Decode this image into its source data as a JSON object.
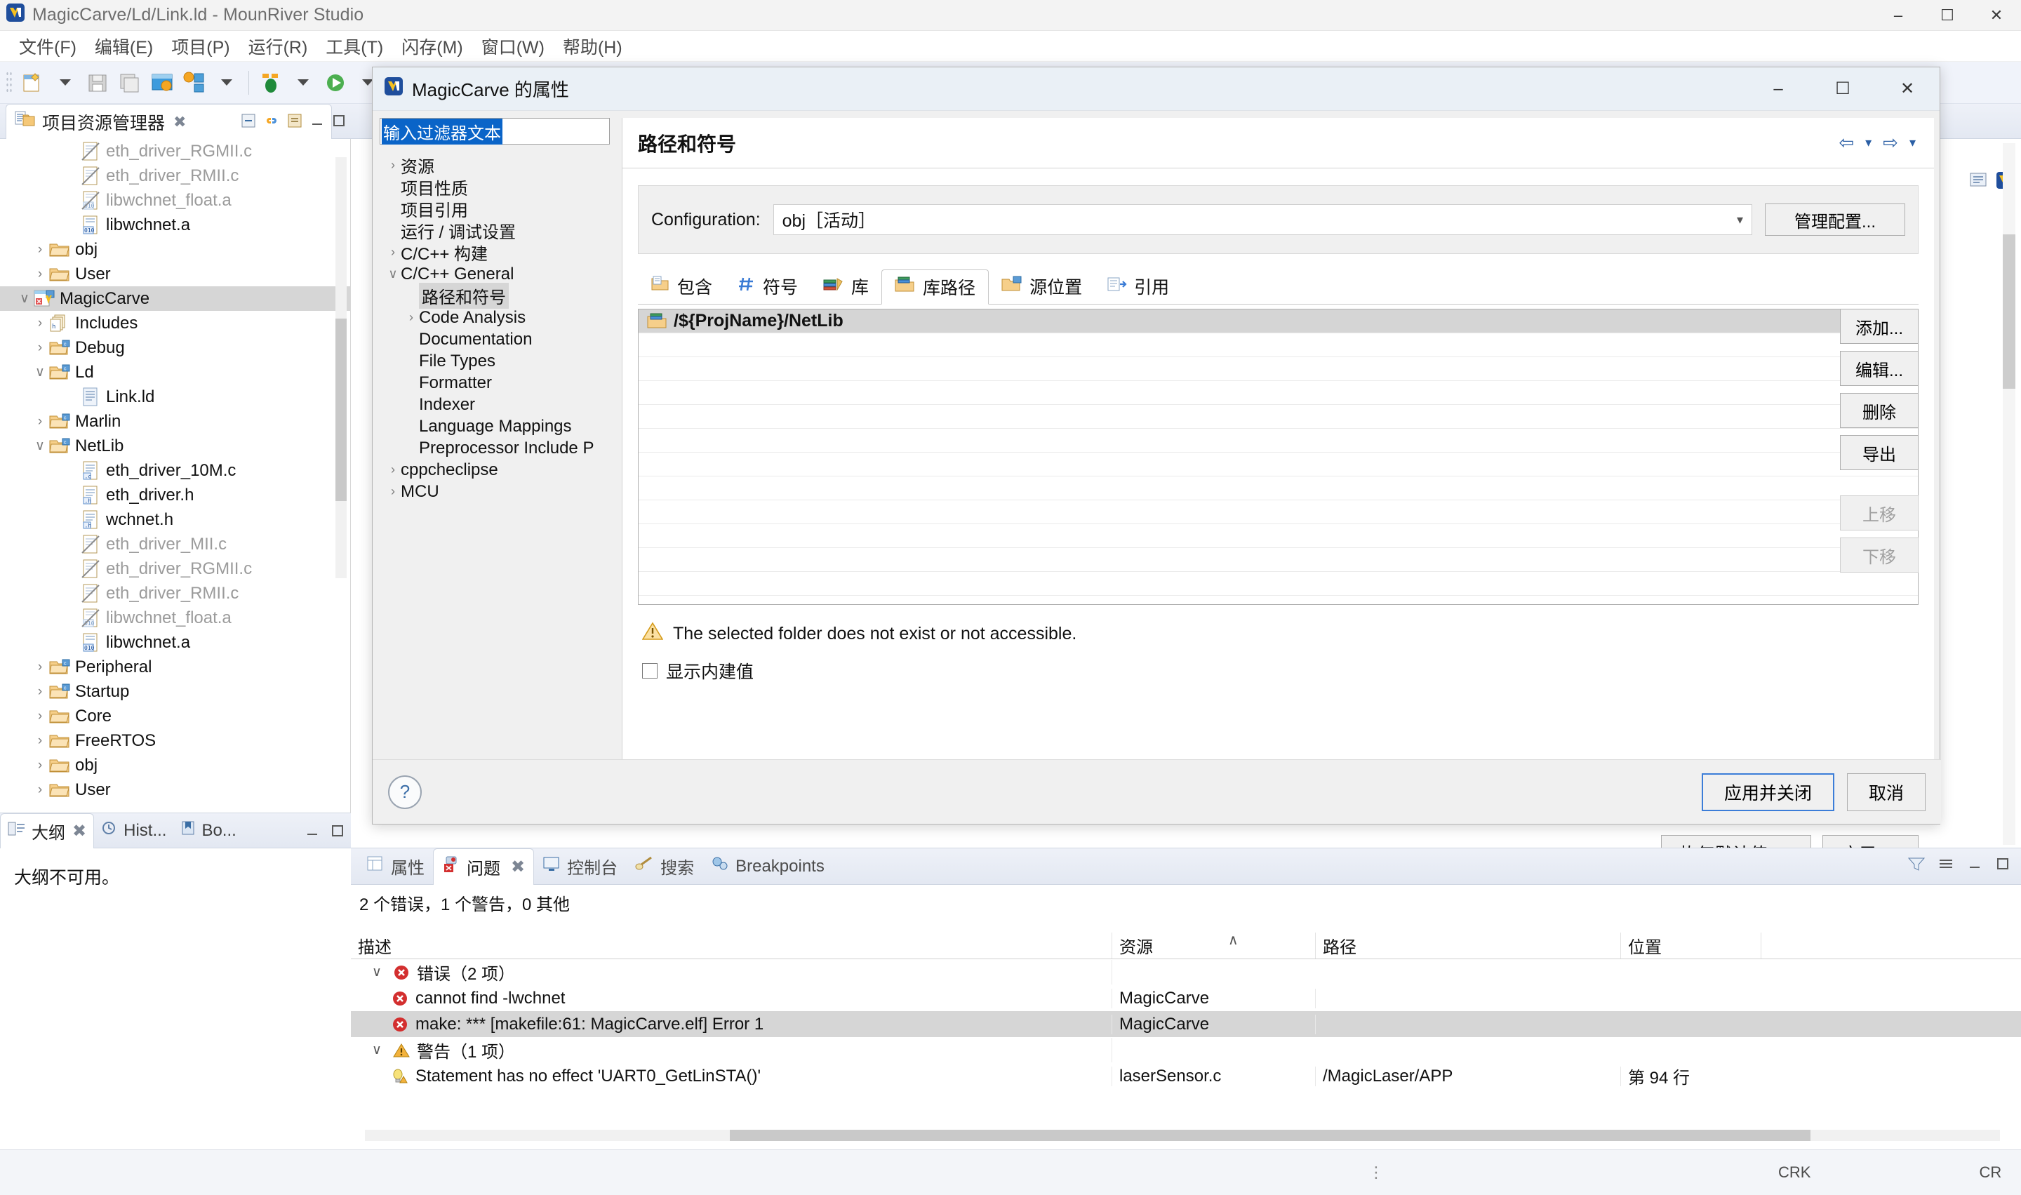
{
  "window": {
    "title": "MagicCarve/Ld/Link.ld - MounRiver Studio",
    "minimize": "–",
    "maximize": "☐",
    "close": "✕"
  },
  "menubar": {
    "items": [
      {
        "label": "文件(F)"
      },
      {
        "label": "编辑(E)"
      },
      {
        "label": "项目(P)"
      },
      {
        "label": "运行(R)"
      },
      {
        "label": "工具(T)"
      },
      {
        "label": "闪存(M)"
      },
      {
        "label": "窗口(W)"
      },
      {
        "label": "帮助(H)"
      }
    ]
  },
  "project_explorer": {
    "tab_label": "项目资源管理器",
    "close_glyph": "✖",
    "tree": [
      {
        "label": "eth_driver_RGMII.c",
        "indent": 4,
        "arrow": "",
        "icon": "c-file-excluded",
        "dim": true
      },
      {
        "label": "eth_driver_RMII.c",
        "indent": 4,
        "arrow": "",
        "icon": "c-file-excluded",
        "dim": true
      },
      {
        "label": "libwchnet_float.a",
        "indent": 4,
        "arrow": "",
        "icon": "archive-excluded",
        "dim": true
      },
      {
        "label": "libwchnet.a",
        "indent": 4,
        "arrow": "",
        "icon": "archive",
        "dim": false
      },
      {
        "label": "obj",
        "indent": 2,
        "arrow": "›",
        "icon": "folder",
        "dim": false
      },
      {
        "label": "User",
        "indent": 2,
        "arrow": "›",
        "icon": "folder",
        "dim": false
      },
      {
        "label": "MagicCarve",
        "indent": 1,
        "arrow": "∨",
        "icon": "project",
        "dim": false,
        "selected": true
      },
      {
        "label": "Includes",
        "indent": 2,
        "arrow": "›",
        "icon": "includes",
        "dim": false
      },
      {
        "label": "Debug",
        "indent": 2,
        "arrow": "›",
        "icon": "cfolder",
        "dim": false
      },
      {
        "label": "Ld",
        "indent": 2,
        "arrow": "∨",
        "icon": "cfolder",
        "dim": false
      },
      {
        "label": "Link.ld",
        "indent": 4,
        "arrow": "",
        "icon": "file",
        "dim": false
      },
      {
        "label": "Marlin",
        "indent": 2,
        "arrow": "›",
        "icon": "cfolder",
        "dim": false
      },
      {
        "label": "NetLib",
        "indent": 2,
        "arrow": "∨",
        "icon": "cfolder",
        "dim": false
      },
      {
        "label": "eth_driver_10M.c",
        "indent": 4,
        "arrow": "",
        "icon": "c-file",
        "dim": false
      },
      {
        "label": "eth_driver.h",
        "indent": 4,
        "arrow": "",
        "icon": "h-file",
        "dim": false
      },
      {
        "label": "wchnet.h",
        "indent": 4,
        "arrow": "",
        "icon": "h-file",
        "dim": false
      },
      {
        "label": "eth_driver_MII.c",
        "indent": 4,
        "arrow": "",
        "icon": "c-file-excluded",
        "dim": true
      },
      {
        "label": "eth_driver_RGMII.c",
        "indent": 4,
        "arrow": "",
        "icon": "c-file-excluded",
        "dim": true
      },
      {
        "label": "eth_driver_RMII.c",
        "indent": 4,
        "arrow": "",
        "icon": "c-file-excluded",
        "dim": true
      },
      {
        "label": "libwchnet_float.a",
        "indent": 4,
        "arrow": "",
        "icon": "archive-excluded",
        "dim": true
      },
      {
        "label": "libwchnet.a",
        "indent": 4,
        "arrow": "",
        "icon": "archive",
        "dim": false
      },
      {
        "label": "Peripheral",
        "indent": 2,
        "arrow": "›",
        "icon": "cfolder",
        "dim": false
      },
      {
        "label": "Startup",
        "indent": 2,
        "arrow": "›",
        "icon": "cfolder",
        "dim": false
      },
      {
        "label": "Core",
        "indent": 2,
        "arrow": "›",
        "icon": "folder",
        "dim": false
      },
      {
        "label": "FreeRTOS",
        "indent": 2,
        "arrow": "›",
        "icon": "folder",
        "dim": false
      },
      {
        "label": "obj",
        "indent": 2,
        "arrow": "›",
        "icon": "folder",
        "dim": false
      },
      {
        "label": "User",
        "indent": 2,
        "arrow": "›",
        "icon": "folder",
        "dim": false
      }
    ]
  },
  "outline": {
    "tabs": [
      {
        "label": "大纲",
        "active": true,
        "close": "✖"
      },
      {
        "label": "Hist...",
        "active": false
      },
      {
        "label": "Bo...",
        "active": false
      }
    ],
    "message": "大纲不可用。"
  },
  "dialog": {
    "title": "MagicCarve 的属性",
    "minimize": "–",
    "maximize": "☐",
    "close": "✕",
    "filter_text": "输入过滤器文本",
    "tree": [
      {
        "label": "资源",
        "indent": 1,
        "arrow": "›"
      },
      {
        "label": "项目性质",
        "indent": 1,
        "arrow": ""
      },
      {
        "label": "项目引用",
        "indent": 1,
        "arrow": ""
      },
      {
        "label": "运行 / 调试设置",
        "indent": 1,
        "arrow": ""
      },
      {
        "label": "C/C++ 构建",
        "indent": 1,
        "arrow": "›"
      },
      {
        "label": "C/C++ General",
        "indent": 1,
        "arrow": "∨"
      },
      {
        "label": "路径和符号",
        "indent": 2,
        "arrow": "",
        "selected": true
      },
      {
        "label": "Code Analysis",
        "indent": 2,
        "arrow": "›"
      },
      {
        "label": "Documentation",
        "indent": 2,
        "arrow": ""
      },
      {
        "label": "File Types",
        "indent": 2,
        "arrow": ""
      },
      {
        "label": "Formatter",
        "indent": 2,
        "arrow": ""
      },
      {
        "label": "Indexer",
        "indent": 2,
        "arrow": ""
      },
      {
        "label": "Language Mappings",
        "indent": 2,
        "arrow": ""
      },
      {
        "label": "Preprocessor Include P",
        "indent": 2,
        "arrow": ""
      },
      {
        "label": "cppcheclipse",
        "indent": 1,
        "arrow": "›"
      },
      {
        "label": "MCU",
        "indent": 1,
        "arrow": "›"
      }
    ],
    "page_title": "路径和符号",
    "nav": {
      "back": "⇦",
      "back_caret": "▾",
      "forward": "⇨",
      "forward_caret": "▾"
    },
    "configuration_label": "Configuration:",
    "configuration_value": "obj［活动］",
    "configuration_caret": "▾",
    "manage_button": "管理配置...",
    "tabs": [
      {
        "label": "包含",
        "icon": "include-icon",
        "active": false
      },
      {
        "label": "符号",
        "icon": "hash-icon",
        "active": false
      },
      {
        "label": "库",
        "icon": "library-icon",
        "active": false
      },
      {
        "label": "库路径",
        "icon": "library-path-icon",
        "active": true
      },
      {
        "label": "源位置",
        "icon": "source-location-icon",
        "active": false
      },
      {
        "label": "引用",
        "icon": "reference-icon",
        "active": false
      }
    ],
    "list_entries": [
      {
        "label": "/${ProjName}/NetLib",
        "selected": true
      }
    ],
    "side_buttons": [
      {
        "label": "添加...",
        "disabled": false
      },
      {
        "label": "编辑...",
        "disabled": false
      },
      {
        "label": "删除",
        "disabled": false
      },
      {
        "label": "导出",
        "disabled": false
      },
      {
        "label": "上移",
        "disabled": true
      },
      {
        "label": "下移",
        "disabled": true
      }
    ],
    "warning": "The selected folder does not exist or not accessible.",
    "checkbox_label": "显示内建值",
    "checkbox_checked": false,
    "restore_defaults": "恢复默认值(D)",
    "apply": "应用(A)",
    "help": "?",
    "apply_and_close": "应用并关闭",
    "cancel": "取消"
  },
  "problems": {
    "tabs": [
      {
        "label": "属性",
        "icon": "properties-icon",
        "active": false
      },
      {
        "label": "问题",
        "icon": "problems-icon",
        "active": true,
        "close": "✖"
      },
      {
        "label": "控制台",
        "icon": "console-icon",
        "active": false
      },
      {
        "label": "搜索",
        "icon": "search-icon",
        "active": false
      },
      {
        "label": "Breakpoints",
        "icon": "breakpoints-icon",
        "active": false
      }
    ],
    "summary": "2 个错误，1 个警告，0 其他",
    "columns": [
      "描述",
      "资源",
      "路径",
      "位置"
    ],
    "sort_arrow": "∧",
    "rows": [
      {
        "kind": "group",
        "icon": "error-icon",
        "arrow": "∨",
        "desc": "错误（2 项）",
        "res": "",
        "path": "",
        "loc": "",
        "selected": false
      },
      {
        "kind": "item",
        "icon": "error-icon",
        "arrow": "",
        "desc": "cannot find -lwchnet",
        "res": "MagicCarve",
        "path": "",
        "loc": "",
        "selected": false
      },
      {
        "kind": "item",
        "icon": "error-icon",
        "arrow": "",
        "desc": "make: *** [makefile:61: MagicCarve.elf] Error 1",
        "res": "MagicCarve",
        "path": "",
        "loc": "",
        "selected": true
      },
      {
        "kind": "group",
        "icon": "warning-icon",
        "arrow": "∨",
        "desc": "警告（1 项）",
        "res": "",
        "path": "",
        "loc": "",
        "selected": false
      },
      {
        "kind": "item",
        "icon": "warning-bulb-icon",
        "arrow": "",
        "desc": "Statement has no effect 'UART0_GetLinSTA()'",
        "res": "laserSensor.c",
        "path": "/MagicLaser/APP",
        "loc": "第 94 行",
        "selected": false
      }
    ]
  },
  "statusbar": {
    "grip": "⋮",
    "item1": "CRK",
    "item2": "CR"
  },
  "colors": {
    "accent": "#0a64c8",
    "error": "#d32f2f",
    "warning": "#f3b23c",
    "selection": "#d6d6d6"
  }
}
